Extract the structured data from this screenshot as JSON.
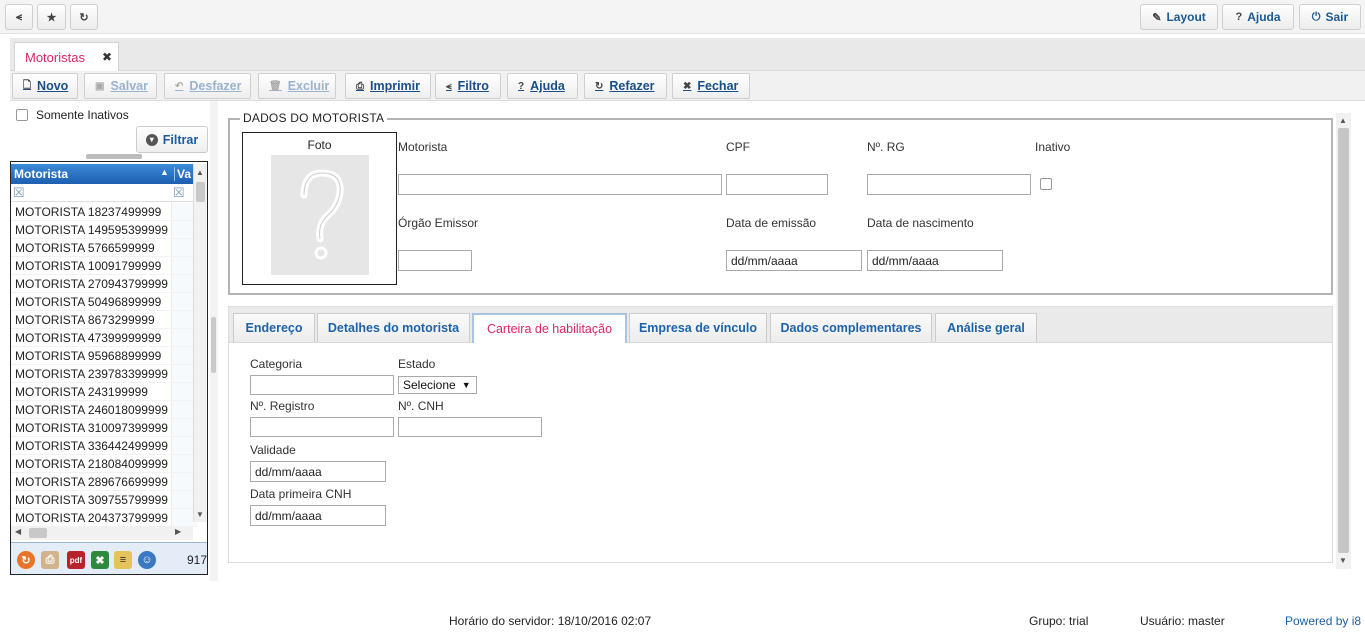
{
  "topbar": {
    "left_icons": [
      "pin-icon",
      "star-icon",
      "refresh-icon"
    ],
    "layout_label": "Layout",
    "help_label": "Ajuda",
    "exit_label": "Sair"
  },
  "document_tab": {
    "title": "Motoristas"
  },
  "toolbar": {
    "new": "Novo",
    "save": "Salvar",
    "undo": "Desfazer",
    "delete": "Excluir",
    "print": "Imprimir",
    "filter": "Filtro",
    "help": "Ajuda",
    "redo": "Refazer",
    "close": "Fechar"
  },
  "sidebar": {
    "only_inactive_label": "Somente Inativos",
    "filter_button": "Filtrar",
    "grid": {
      "col_driver": "Motorista",
      "col_value": "Va",
      "rows": [
        "MOTORISTA 18237499999",
        "MOTORISTA 149595399999",
        "MOTORISTA 5766599999",
        "MOTORISTA 10091799999",
        "MOTORISTA 270943799999",
        "MOTORISTA 50496899999",
        "MOTORISTA 8673299999",
        "MOTORISTA 47399999999",
        "MOTORISTA 95968899999",
        "MOTORISTA 239783399999",
        "MOTORISTA 243199999",
        "MOTORISTA 246018099999",
        "MOTORISTA 310097399999",
        "MOTORISTA 336442499999",
        "MOTORISTA 218084099999",
        "MOTORISTA 289676699999",
        "MOTORISTA 309755799999",
        "MOTORISTA 204373799999"
      ],
      "footer_count": "917",
      "footer_icons": [
        "refresh-icon",
        "print-icon",
        "pdf-icon",
        "excel-icon",
        "notes-icon",
        "user-icon"
      ],
      "pdf_text": "pdf"
    }
  },
  "driver_data": {
    "legend": "DADOS DO MOTORISTA",
    "photo_label": "Foto",
    "driver_label": "Motorista",
    "cpf_label": "CPF",
    "rg_label": "Nº. RG",
    "inactive_label": "Inativo",
    "issuer_label": "Órgão Emissor",
    "issue_date_label": "Data de emissão",
    "birth_date_label": "Data de nascimento",
    "issue_date_value": "dd/mm/aaaa",
    "birth_date_value": "dd/mm/aaaa"
  },
  "tabs": [
    "Endereço",
    "Detalhes do motorista",
    "Carteira de habilitação",
    "Empresa de vínculo",
    "Dados complementares",
    "Análise geral"
  ],
  "license": {
    "category_label": "Categoria",
    "state_label": "Estado",
    "state_value": "Selecione",
    "registry_label": "Nº. Registro",
    "cnh_label": "Nº. CNH",
    "validity_label": "Validade",
    "validity_value": "dd/mm/aaaa",
    "first_cnh_label": "Data primeira CNH",
    "first_cnh_value": "dd/mm/aaaa"
  },
  "status": {
    "server_time": "Horário do servidor: 18/10/2016 02:07",
    "group": "Grupo: trial",
    "user": "Usuário: master",
    "powered": "Powered by i8"
  },
  "colors": {
    "accent_pink": "#d9266a",
    "link_blue": "#1a4f8a",
    "grid_header": "#1d5fb0"
  }
}
